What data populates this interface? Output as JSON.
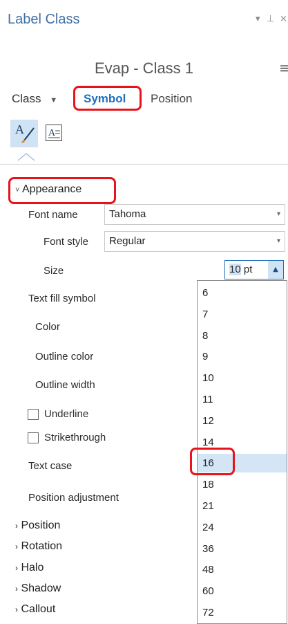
{
  "window": {
    "title": "Label Class",
    "pin_icon": "⊥",
    "close_icon": "×"
  },
  "header": {
    "class_title": "Evap - Class 1",
    "menu_icon": "≡"
  },
  "tabs": {
    "class": "Class",
    "class_caret": "▼",
    "symbol": "Symbol",
    "position": "Position"
  },
  "appearance": {
    "heading": "Appearance",
    "font_name_label": "Font name",
    "font_name_value": "Tahoma",
    "font_style_label": "Font style",
    "font_style_value": "Regular",
    "size_label": "Size",
    "size_value": "10",
    "size_unit": "pt",
    "text_fill_label": "Text fill symbol",
    "color_label": "Color",
    "outline_color_label": "Outline color",
    "outline_width_label": "Outline width",
    "underline_label": "Underline",
    "strikethrough_label": "Strikethrough",
    "text_case_label": "Text case",
    "position_adjustment_label": "Position adjustment"
  },
  "size_options": [
    "6",
    "7",
    "8",
    "9",
    "10",
    "11",
    "12",
    "14",
    "16",
    "18",
    "21",
    "24",
    "36",
    "48",
    "60",
    "72"
  ],
  "selected_size": "16",
  "sections": [
    "Position",
    "Rotation",
    "Halo",
    "Shadow",
    "Callout"
  ],
  "colors": {
    "accent": "#1f6fbd",
    "highlight": "#e8121a",
    "selected_bg": "#d4e5f5"
  }
}
